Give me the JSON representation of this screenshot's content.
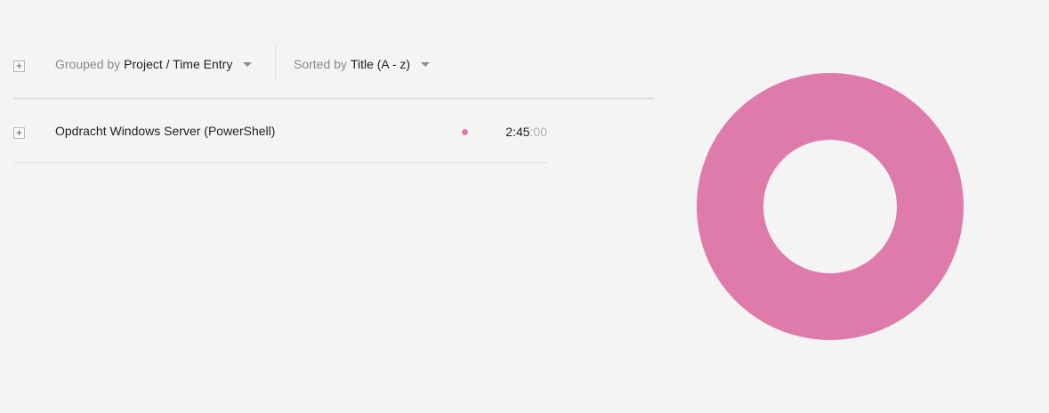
{
  "toolbar": {
    "expand_symbol": "+",
    "group": {
      "prefix": "Grouped by",
      "value": "Project / Time Entry"
    },
    "sort": {
      "prefix": "Sorted by",
      "value": "Title (A - z)"
    }
  },
  "rows": [
    {
      "expand_symbol": "+",
      "title": "Opdracht Windows Server (PowerShell)",
      "duration_main": "2:45",
      "duration_secs": ":00",
      "color": "#df7bab"
    }
  ],
  "chart_data": {
    "type": "pie",
    "variant": "donut",
    "slices": [
      {
        "label": "Opdracht Windows Server (PowerShell)",
        "value": 165,
        "unit": "minutes",
        "color": "#df7bab"
      }
    ]
  }
}
